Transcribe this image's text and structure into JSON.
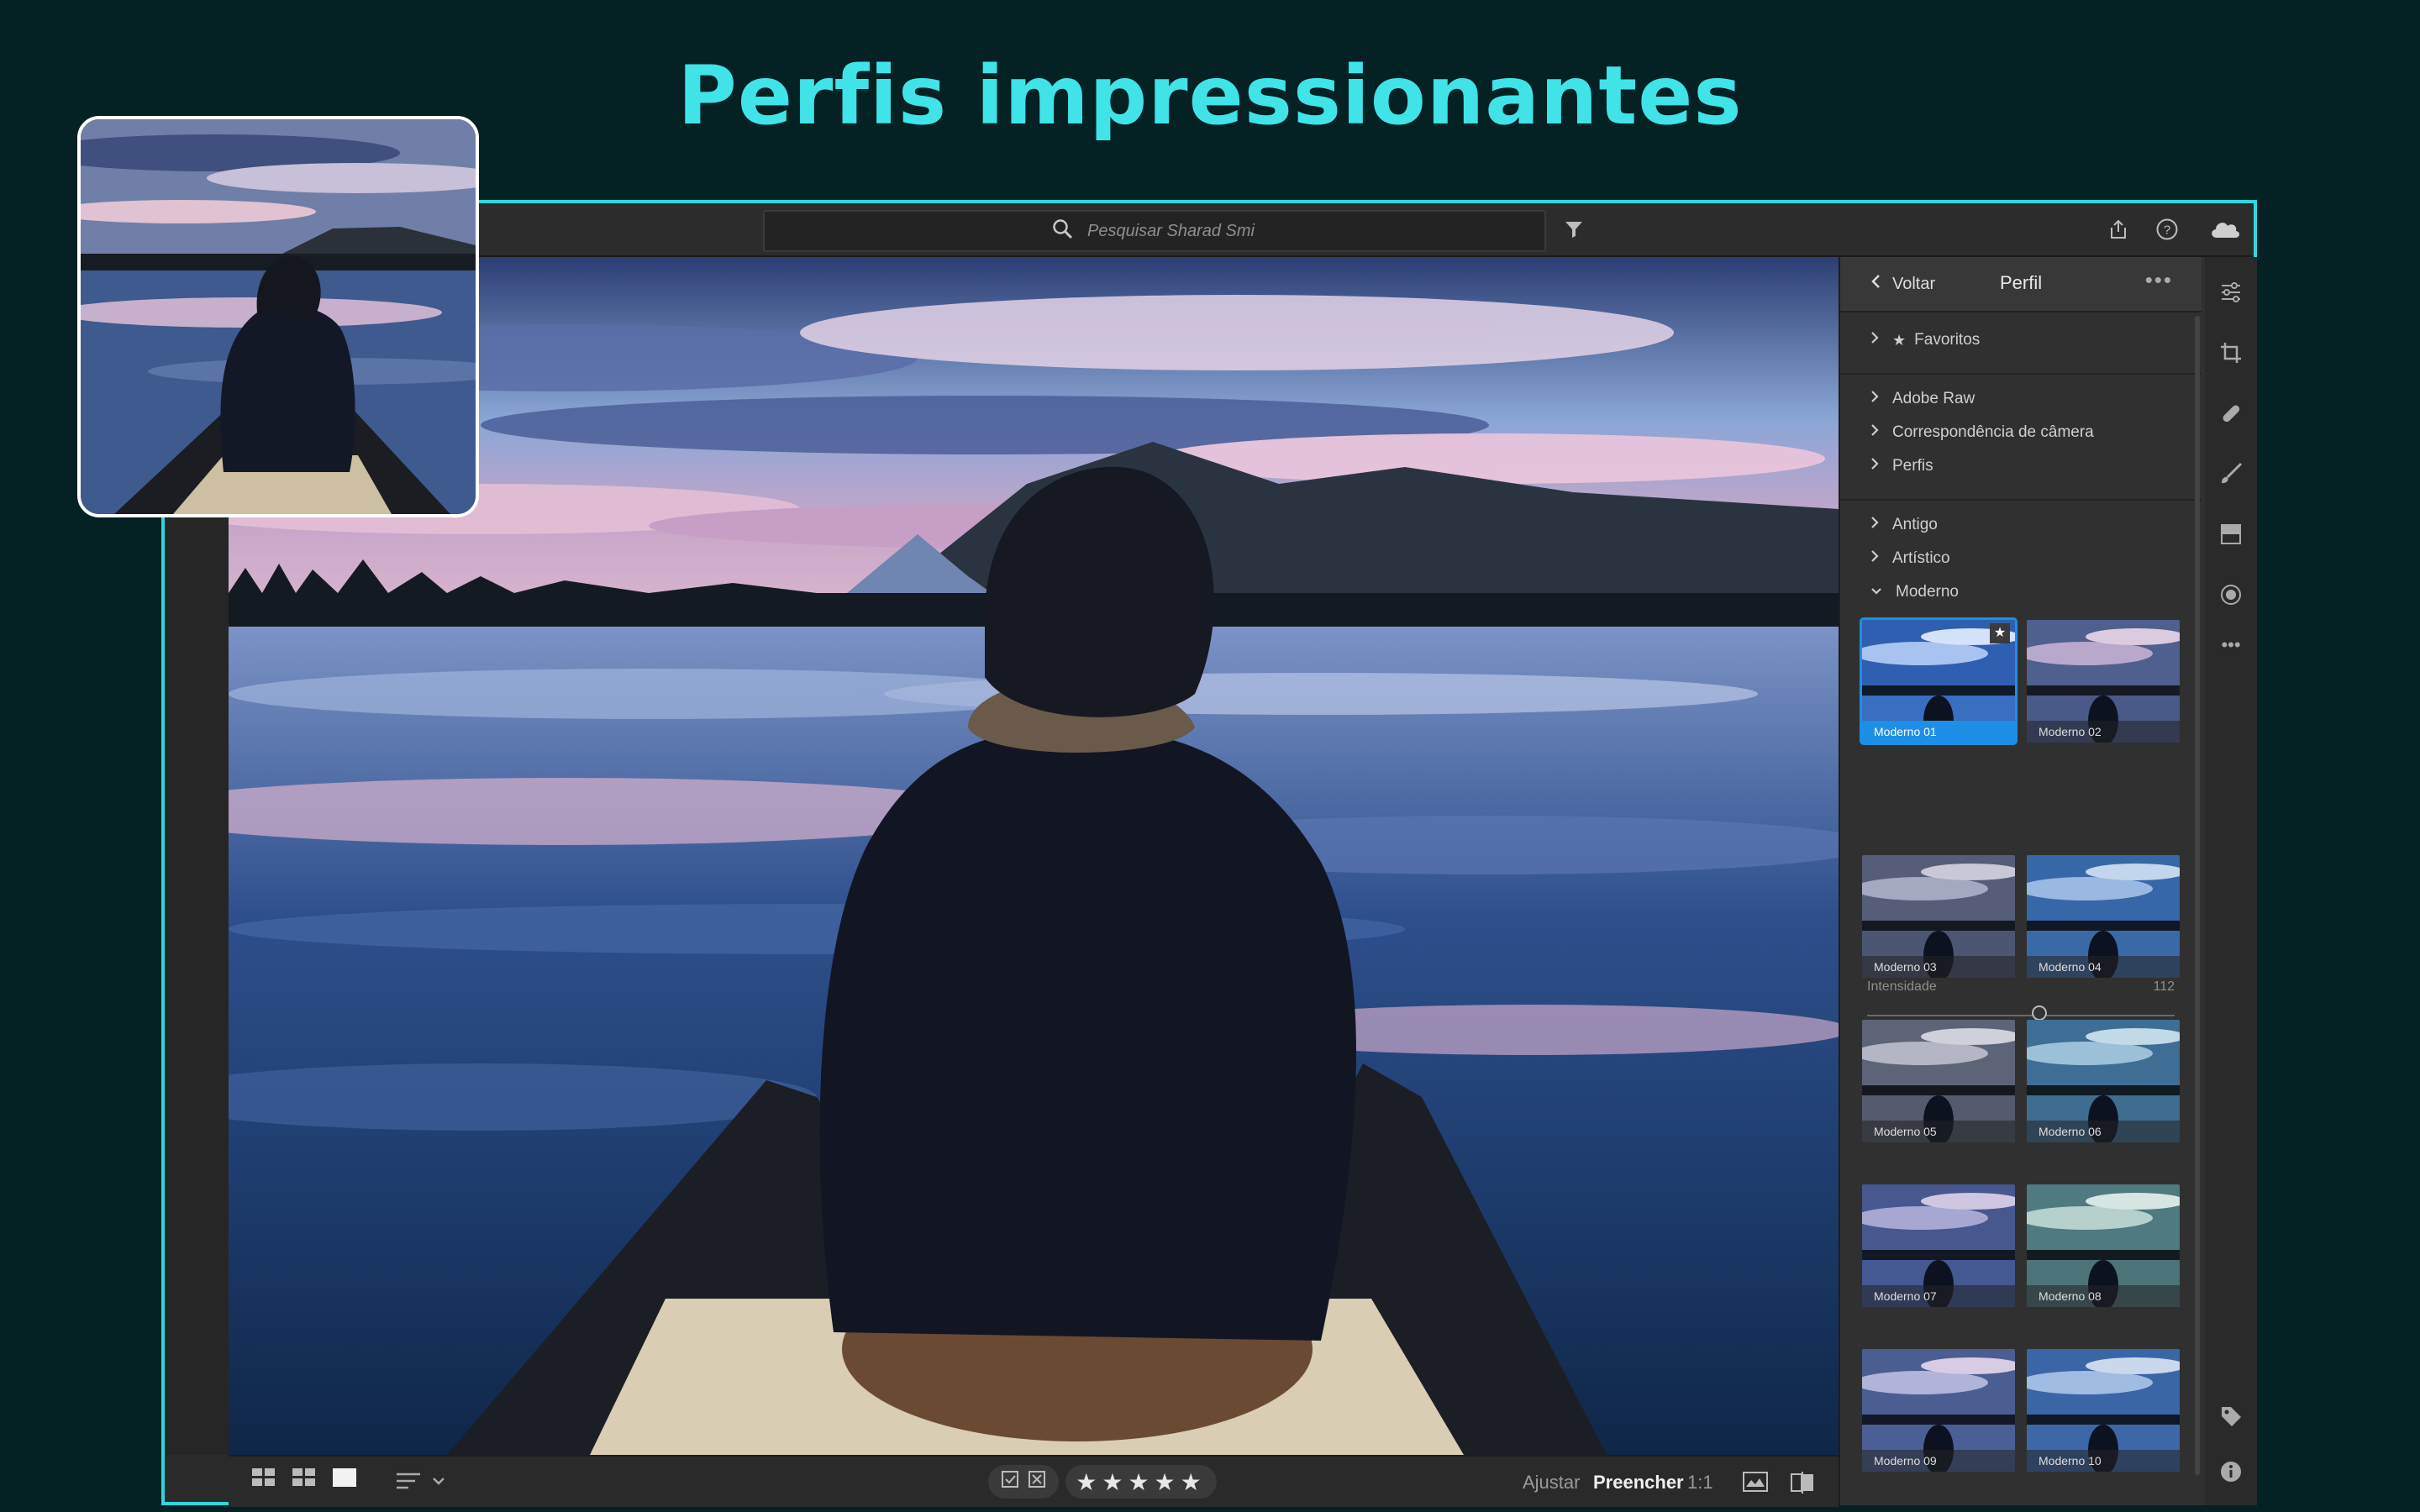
{
  "headline": "Perfis impressionantes",
  "search": {
    "placeholder": "Pesquisar Sharad Smith"
  },
  "panel": {
    "back_label": "Voltar",
    "title": "Perfil",
    "favorites_label": "Favoritos",
    "groups_a": [
      "Adobe Raw",
      "Correspondência de câmera",
      "Perfis"
    ],
    "groups_b": [
      "Antigo",
      "Artístico",
      "Moderno"
    ],
    "intensity": {
      "label": "Intensidade",
      "value": "112",
      "fraction": 0.56
    },
    "thumbnails": [
      "Moderno 01",
      "Moderno 02",
      "Moderno 03",
      "Moderno 04",
      "Moderno 05",
      "Moderno 06",
      "Moderno 07",
      "Moderno 08",
      "Moderno 09",
      "Moderno 10"
    ],
    "selected_thumbnail": "Moderno 01"
  },
  "bottombar": {
    "adjust_label": "Ajustar",
    "fill_label": "Preencher",
    "ratio_label": "1:1",
    "stars": "★★★★★"
  },
  "icons": {
    "search": "search-icon",
    "filter": "filter-icon",
    "share": "share-icon",
    "help": "help-icon",
    "cloud": "cloud-icon"
  },
  "colors": {
    "accent": "#3fe3e8",
    "background": "#042124",
    "selection": "#1d8fe6"
  }
}
